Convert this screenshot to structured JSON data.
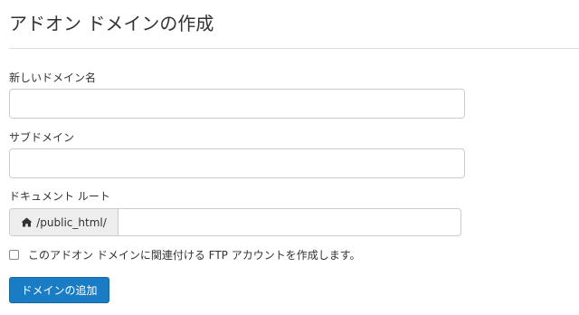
{
  "page": {
    "title": "アドオン ドメインの作成"
  },
  "form": {
    "new_domain_label": "新しいドメイン名",
    "new_domain_value": "",
    "subdomain_label": "サブドメイン",
    "subdomain_value": "",
    "docroot_label": "ドキュメント ルート",
    "docroot_prefix": "/public_html/",
    "docroot_prefix_icon": "home-icon",
    "docroot_value": "",
    "ftp_checkbox_label": "このアドオン ドメインに関連付ける FTP アカウントを作成します。",
    "ftp_checkbox_checked": false,
    "submit_label": "ドメインの追加"
  },
  "colors": {
    "button_bg": "#1a7cc4",
    "button_text": "#ffffff",
    "border": "#cccccc",
    "addon_bg": "#eeeeee"
  }
}
